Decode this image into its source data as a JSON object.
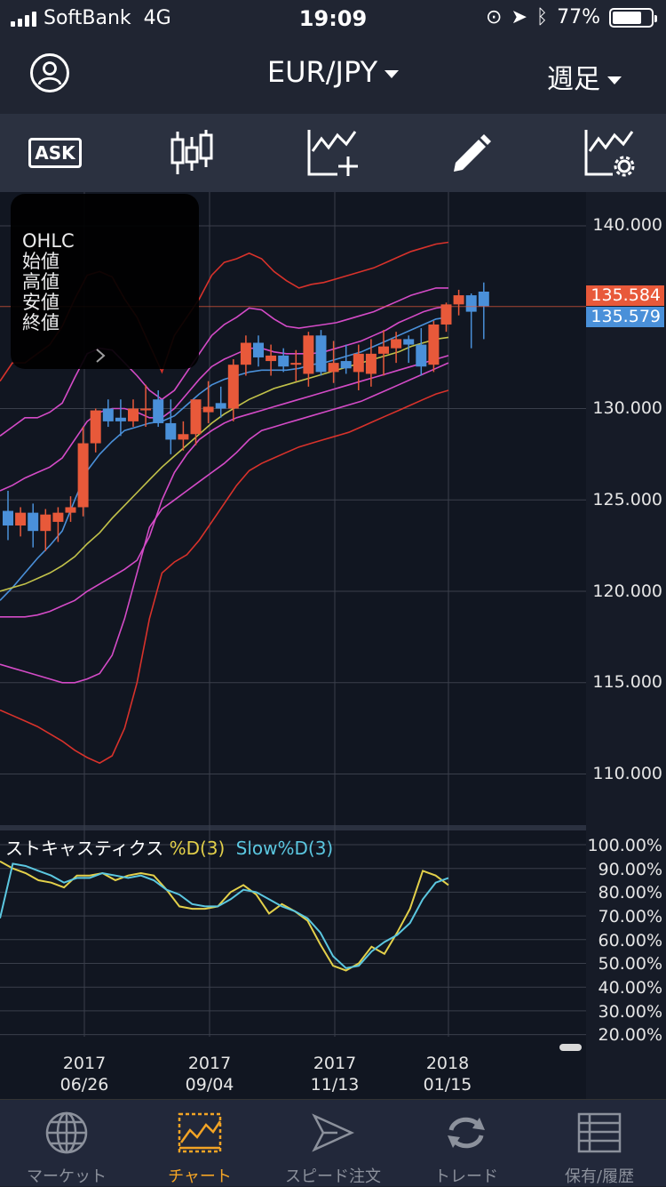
{
  "status": {
    "carrier": "SoftBank",
    "network": "4G",
    "time": "19:09",
    "battery": "77%"
  },
  "header": {
    "pair": "EUR/JPY",
    "period": "週足"
  },
  "toolbar": {
    "ask_label": "ASK"
  },
  "ohlc": {
    "labels": [
      "OHLC",
      "始値",
      "高値",
      "安値",
      "終値"
    ]
  },
  "price_axis": {
    "ticks": [
      "140.000",
      "130.000",
      "125.000",
      "120.000",
      "115.000",
      "110.000"
    ],
    "last_ask": "135.584",
    "last_bid": "135.579"
  },
  "stoch": {
    "title": "ストキャスティクス",
    "d_label": "%D(3)",
    "slow_label": "Slow%D(3)",
    "ticks": [
      "100.00%",
      "90.00%",
      "80.00%",
      "70.00%",
      "60.00%",
      "50.00%",
      "40.00%",
      "30.00%",
      "20.00%"
    ]
  },
  "x_axis": {
    "labels": [
      [
        "2017",
        "06/26"
      ],
      [
        "2017",
        "09/04"
      ],
      [
        "2017",
        "11/13"
      ],
      [
        "2018",
        "01/15"
      ]
    ]
  },
  "tabs": [
    "マーケット",
    "チャート",
    "スピード注文",
    "トレード",
    "保有/履歴"
  ],
  "colors": {
    "bull": "#e8593a",
    "bear": "#4a90d9",
    "accent": "#f3a425"
  },
  "chart_data": [
    {
      "type": "candlestick",
      "ylim": [
        108.5,
        144.8
      ],
      "x_labels": [
        "2017 06/26",
        "2017 09/04",
        "2017 11/13",
        "2018 01/15"
      ],
      "candles": [
        [
          124.4,
          125.5,
          122.8,
          123.6
        ],
        [
          123.6,
          124.6,
          123.0,
          124.3
        ],
        [
          124.3,
          124.8,
          122.4,
          123.3
        ],
        [
          123.3,
          124.5,
          122.2,
          124.2
        ],
        [
          123.8,
          124.6,
          122.7,
          124.3
        ],
        [
          124.3,
          125.2,
          123.8,
          124.6
        ],
        [
          124.6,
          129.0,
          124.1,
          128.1
        ],
        [
          128.1,
          130.0,
          127.6,
          129.9
        ],
        [
          130.0,
          130.5,
          129.0,
          129.3
        ],
        [
          129.5,
          130.5,
          128.5,
          129.3
        ],
        [
          129.3,
          130.5,
          129.0,
          130.0
        ],
        [
          130.0,
          131.3,
          129.0,
          130.0
        ],
        [
          130.5,
          131.0,
          129.0,
          129.2
        ],
        [
          129.2,
          130.5,
          127.5,
          128.3
        ],
        [
          128.3,
          129.3,
          127.7,
          128.6
        ],
        [
          128.6,
          130.5,
          128.0,
          130.5
        ],
        [
          129.8,
          131.5,
          129.2,
          130.1
        ],
        [
          130.3,
          131.2,
          129.5,
          130.0
        ],
        [
          130.0,
          132.7,
          129.3,
          132.4
        ],
        [
          132.4,
          134.0,
          131.8,
          133.6
        ],
        [
          133.6,
          134.0,
          132.3,
          132.8
        ],
        [
          132.6,
          133.5,
          131.8,
          132.9
        ],
        [
          132.9,
          133.3,
          132.0,
          132.3
        ],
        [
          132.4,
          133.2,
          131.5,
          132.5
        ],
        [
          131.9,
          134.2,
          131.2,
          134.0
        ],
        [
          134.0,
          134.3,
          131.8,
          132.0
        ],
        [
          132.0,
          133.7,
          131.4,
          132.5
        ],
        [
          132.6,
          133.5,
          131.9,
          132.2
        ],
        [
          132.0,
          133.5,
          131.0,
          133.0
        ],
        [
          131.9,
          133.8,
          131.2,
          133.0
        ],
        [
          133.0,
          134.3,
          131.8,
          133.4
        ],
        [
          133.3,
          134.2,
          132.5,
          133.8
        ],
        [
          133.8,
          134.0,
          132.5,
          133.5
        ],
        [
          133.5,
          134.4,
          131.8,
          132.3
        ],
        [
          132.4,
          134.8,
          132.0,
          134.6
        ],
        [
          134.6,
          135.8,
          134.2,
          135.7
        ],
        [
          135.7,
          136.5,
          135.1,
          136.2
        ],
        [
          136.2,
          136.3,
          133.3,
          135.3
        ],
        [
          136.4,
          136.9,
          133.8,
          135.6
        ]
      ],
      "current": {
        "ask": 135.584,
        "bid": 135.579
      }
    },
    {
      "type": "line",
      "title": "ストキャスティクス",
      "ylim": [
        20,
        100
      ],
      "series": [
        {
          "name": "%D(3)",
          "values": [
            93,
            90,
            88,
            85,
            84,
            82,
            87,
            87,
            88,
            85,
            87,
            88,
            87,
            81,
            74,
            73,
            73,
            74,
            80,
            83,
            79,
            71,
            75,
            72,
            68,
            58,
            49,
            47,
            50,
            57,
            54,
            63,
            73,
            89,
            87,
            83
          ]
        },
        {
          "name": "Slow%D(3)",
          "values": [
            69,
            92,
            91,
            89,
            87,
            84,
            86,
            86,
            88,
            87,
            86,
            87,
            85,
            81,
            79,
            75,
            74,
            74,
            77,
            81,
            80,
            77,
            74,
            72,
            69,
            63,
            53,
            48,
            49,
            55,
            59,
            62,
            67,
            77,
            84,
            86
          ]
        }
      ]
    }
  ]
}
